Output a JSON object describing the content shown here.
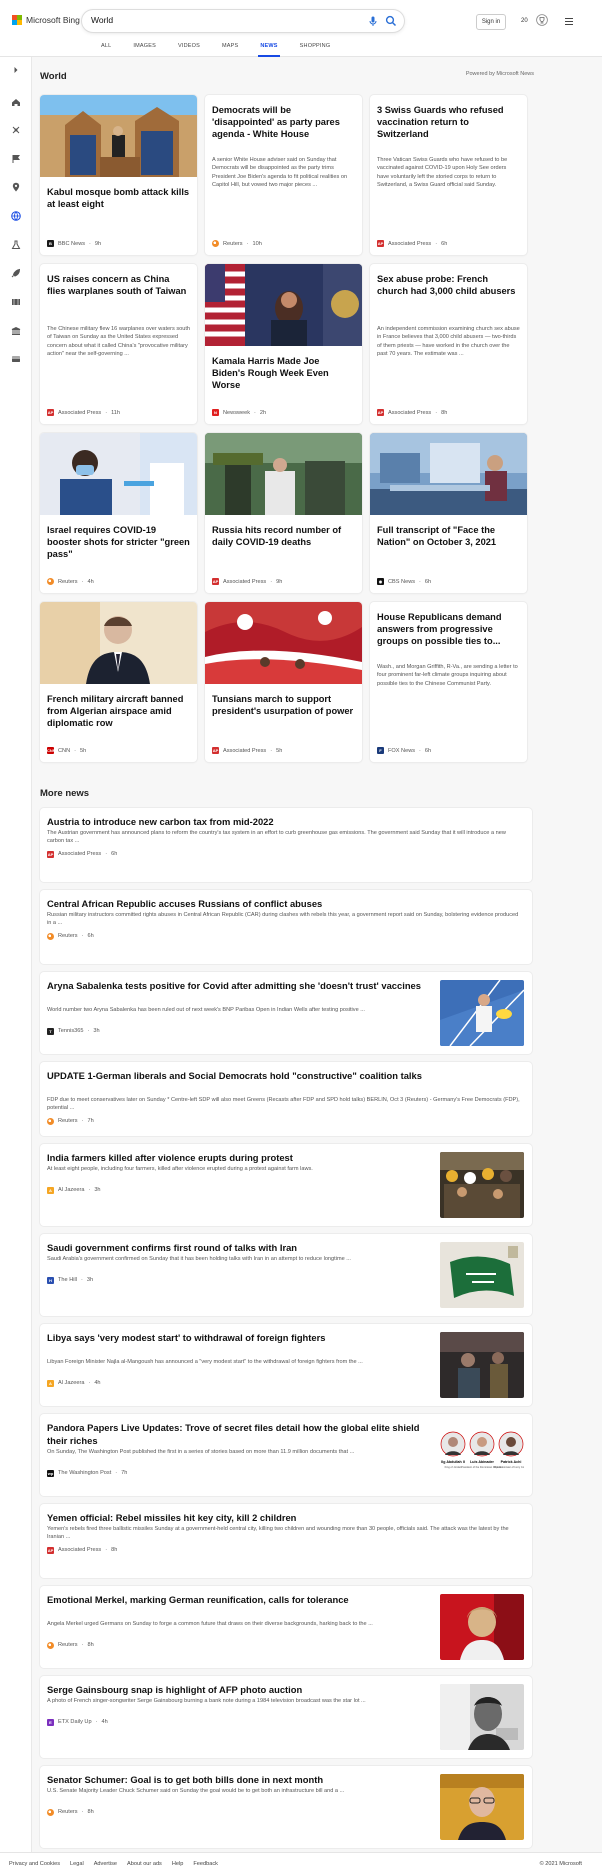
{
  "brand": {
    "name": "Microsoft Bing",
    "colors": [
      "#f25022",
      "#7fba00",
      "#00a4ef",
      "#ffb900"
    ]
  },
  "search": {
    "query": "World"
  },
  "header": {
    "signin": "Sign in",
    "rewards": "20"
  },
  "tabs": [
    {
      "label": "ALL"
    },
    {
      "label": "IMAGES"
    },
    {
      "label": "VIDEOS"
    },
    {
      "label": "MAPS"
    },
    {
      "label": "NEWS",
      "active": true
    },
    {
      "label": "SHOPPING"
    }
  ],
  "sidebar": {
    "icons": [
      "chevron-right-icon",
      "home-icon",
      "discover-icon",
      "flag-icon",
      "location-icon",
      "world-icon",
      "science-icon",
      "rocket-icon",
      "movie-icon",
      "bank-icon",
      "card-icon"
    ]
  },
  "section": {
    "title": "World",
    "powered": "Powered by Microsoft News"
  },
  "top_cards": [
    {
      "title": "Kabul mosque bomb attack kills at least eight",
      "desc": "",
      "source": "BBC News",
      "time": "9h",
      "logo_color": "#1a1a1a",
      "logo_text": "B",
      "has_image": true
    },
    {
      "title": "Democrats will be 'disappointed' as party pares agenda - White House",
      "desc": "A senior White House adviser said on Sunday that Democrats will be disappointed as the party trims President Joe Biden's agenda to fit political realities on Capitol Hill, but vowed two major pieces ...",
      "source": "Reuters",
      "time": "10h",
      "logo_color": "#f28c28",
      "logo_text": "",
      "has_image": false
    },
    {
      "title": "3 Swiss Guards who refused vaccination return to Switzerland",
      "desc": "Three Vatican Swiss Guards who have refused to be vaccinated against COVID-19 upon Holy See orders have voluntarily left the storied corps to return to Switzerland, a Swiss Guard official said Sunday.",
      "source": "Associated Press",
      "time": "6h",
      "logo_color": "#d32f2f",
      "logo_text": "AP",
      "has_image": false
    },
    {
      "title": "US raises concern as China flies warplanes south of Taiwan",
      "desc": "The Chinese military flew 16 warplanes over waters south of Taiwan on Sunday as the United States expressed concern about what it called China's \"provocative military action\" near the self-governing ...",
      "source": "Associated Press",
      "time": "11h",
      "logo_color": "#d32f2f",
      "logo_text": "AP",
      "has_image": false
    },
    {
      "title": "Kamala Harris Made Joe Biden's Rough Week Even Worse",
      "desc": "",
      "source": "Newsweek",
      "time": "2h",
      "logo_color": "#e02020",
      "logo_text": "N",
      "has_image": true
    },
    {
      "title": "Sex abuse probe: French church had 3,000 child abusers",
      "desc": "An independent commission examining church sex abuse in France believes that 3,000 child abusers — two-thirds of them priests — have worked in the church over the past 70 years. The estimate was ...",
      "source": "Associated Press",
      "time": "8h",
      "logo_color": "#d32f2f",
      "logo_text": "AP",
      "has_image": false
    },
    {
      "title": "Israel requires COVID-19 booster shots for stricter \"green pass\"",
      "desc": "",
      "source": "Reuters",
      "time": "4h",
      "logo_color": "#f28c28",
      "logo_text": "",
      "has_image": true
    },
    {
      "title": "Russia hits record number of daily COVID-19 deaths",
      "desc": "",
      "source": "Associated Press",
      "time": "9h",
      "logo_color": "#d32f2f",
      "logo_text": "AP",
      "has_image": true
    },
    {
      "title": "Full transcript of \"Face the Nation\" on October 3, 2021",
      "desc": "",
      "source": "CBS News",
      "time": "6h",
      "logo_color": "#111111",
      "logo_text": "◉",
      "has_image": true
    },
    {
      "title": "French military aircraft banned from Algerian airspace amid diplomatic row",
      "desc": "",
      "source": "CNN",
      "time": "5h",
      "logo_color": "#cc0000",
      "logo_text": "CNN",
      "has_image": true
    },
    {
      "title": "Tunsians march to support president's usurpation of power",
      "desc": "",
      "source": "Associated Press",
      "time": "5h",
      "logo_color": "#d32f2f",
      "logo_text": "AP",
      "has_image": true
    },
    {
      "title": "House Republicans demand answers from progressive groups on possible ties to...",
      "desc": "Wash., and Morgan Griffith, R-Va., are sending a letter to four prominent far-left climate groups inquiring about possible ties to the Chinese Communist Party.",
      "source": "FOX News",
      "time": "6h",
      "logo_color": "#1a3a7a",
      "logo_text": "F",
      "has_image": false
    }
  ],
  "more": {
    "title": "More news"
  },
  "news_list": [
    {
      "title": "Austria to introduce new carbon tax from mid-2022",
      "desc": "The Austrian government has announced plans to reform the country's tax system in an effort to curb greenhouse gas emissions. The government said Sunday that it will introduce a new carbon tax ...",
      "source": "Associated Press",
      "time": "6h",
      "logo_color": "#d32f2f",
      "logo_text": "AP",
      "image": ""
    },
    {
      "title": "Central African Republic accuses Russians of conflict abuses",
      "desc": "Russian military instructors committed rights abuses in Central African Republic (CAR) during clashes with rebels this year, a government report said on Sunday, bolstering evidence produced in a ...",
      "source": "Reuters",
      "time": "6h",
      "logo_color": "#f28c28",
      "logo_text": "",
      "image": ""
    },
    {
      "title": "Aryna Sabalenka tests positive for Covid after admitting she 'doesn't trust' vaccines",
      "desc": "World number two Aryna Sabalenka has been ruled out of next week's BNP Paribas Open in Indian Wells after testing positive ...",
      "source": "Tennis365",
      "time": "3h",
      "logo_color": "#222222",
      "logo_text": "T",
      "image": "tennis"
    },
    {
      "title": "UPDATE 1-German liberals and Social Democrats hold \"constructive\" coalition talks",
      "desc": "FDP due to meet conservatives later on Sunday * Centre-left SDP will also meet Greens (Recasts after FDP and SPD hold talks) BERLIN, Oct 3 (Reuters) - Germany's Free Democrats (FDP), potential ...",
      "source": "Reuters",
      "time": "7h",
      "logo_color": "#f28c28",
      "logo_text": "",
      "image": ""
    },
    {
      "title": "India farmers killed after violence erupts during protest",
      "desc": "At least eight people, including four farmers, killed after violence erupted during a protest against farm laws.",
      "source": "Al Jazeera",
      "time": "3h",
      "logo_color": "#f5a623",
      "logo_text": "A",
      "image": "crowd"
    },
    {
      "title": "Saudi government confirms first round of talks with Iran",
      "desc": "Saudi Arabia's government confirmed on Sunday that it has been holding talks with Iran in an attempt to reduce longtime ...",
      "source": "The Hill",
      "time": "3h",
      "logo_color": "#2a4fb0",
      "logo_text": "H",
      "image": "flag"
    },
    {
      "title": "Libya says 'very modest start' to withdrawal of foreign fighters",
      "desc": "Libyan Foreign Minister Najla al-Mangoush has announced a \"very modest start\" to the withdrawal of foreign fighters from the ...",
      "source": "Al Jazeera",
      "time": "4h",
      "logo_color": "#f5a623",
      "logo_text": "A",
      "image": "fighters"
    },
    {
      "title": "Pandora Papers Live Updates: Trove of secret files detail how the global elite shield their riches",
      "desc": "On Sunday, The Washington Post published the first in a series of stories based on more than 11.9 million documents that ...",
      "source": "The Washington Post",
      "time": "7h",
      "logo_color": "#111111",
      "logo_text": "wp",
      "image": "portraits",
      "portraits": [
        {
          "name": "Ilg Abdullah II",
          "role": "King of Jordan"
        },
        {
          "name": "Luis Abinader",
          "role": "President of the Dominican Republic"
        },
        {
          "name": "Patrick Achi",
          "role": "Prime minister of Ivory Coast"
        }
      ]
    },
    {
      "title": "Yemen official: Rebel missiles hit key city, kill 2 children",
      "desc": "Yemen's rebels fired three ballistic missiles Sunday at a government-held central city, killing two children and wounding more than 30 people, officials said. The attack was the latest by the Iranian ...",
      "source": "Associated Press",
      "time": "8h",
      "logo_color": "#d32f2f",
      "logo_text": "AP",
      "image": ""
    },
    {
      "title": "Emotional Merkel, marking German reunification, calls for tolerance",
      "desc": "Angela Merkel urged Germans on Sunday to forge a common future that draws on their diverse backgrounds, harking back to the ...",
      "source": "Reuters",
      "time": "8h",
      "logo_color": "#f28c28",
      "logo_text": "",
      "image": "merkel"
    },
    {
      "title": "Serge Gainsbourg snap is highlight of AFP photo auction",
      "desc": "A photo of French singer-songwriter Serge Gainsbourg burning a bank note during a 1984 television broadcast was the star lot ...",
      "source": "ETX Daily Up",
      "time": "4h",
      "logo_color": "#7b2fbe",
      "logo_text": "E",
      "image": "gainsbourg"
    },
    {
      "title": "Senator Schumer: Goal is to get both bills done in next month",
      "desc": "U.S. Senate Majority Leader Chuck Schumer said on Sunday the goal would be to get both an infrastructure bill and a ...",
      "source": "Reuters",
      "time": "8h",
      "logo_color": "#f28c28",
      "logo_text": "",
      "image": "schumer"
    }
  ],
  "footer": {
    "links": [
      {
        "label": "Privacy and Cookies"
      },
      {
        "label": "Legal"
      },
      {
        "label": "Advertise"
      },
      {
        "label": "About our ads"
      },
      {
        "label": "Help"
      },
      {
        "label": "Feedback"
      }
    ],
    "copyright": "© 2021 Microsoft"
  }
}
